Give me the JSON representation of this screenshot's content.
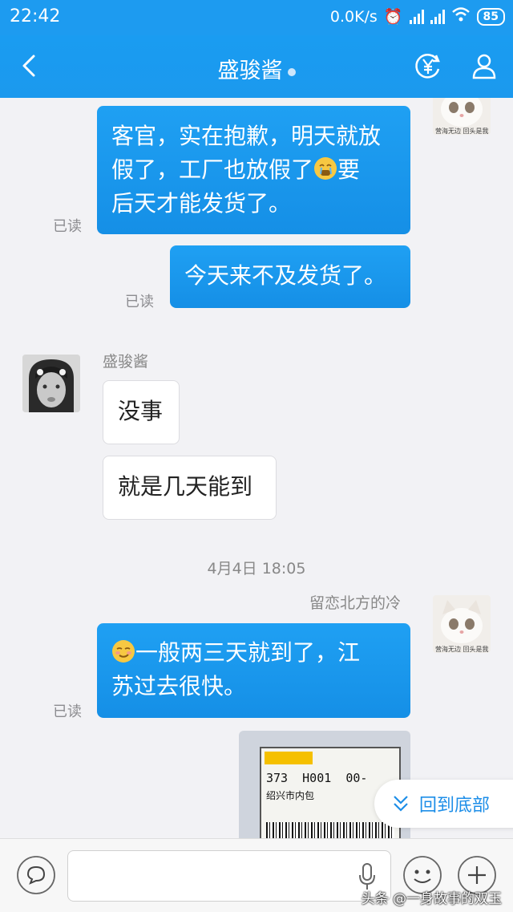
{
  "status": {
    "time": "22:42",
    "net_speed": "0.0K/s",
    "battery": "85"
  },
  "header": {
    "title": "盛骏酱"
  },
  "messages": {
    "m1": {
      "line1": "客官，实在抱歉，明天就放",
      "line2a": "假了，工厂也放假了",
      "line2b": "要",
      "line3": "后天才能发货了。",
      "read": "已读"
    },
    "m2": {
      "text": "今天来不及发货了。",
      "read": "已读"
    },
    "m3": {
      "sender": "盛骏酱",
      "text": "没事"
    },
    "m4": {
      "text": "就是几天能到"
    },
    "timestamp": "4月4日 18:05",
    "m5": {
      "sender": "留恋北方的冷",
      "line1": "一般两三天就到了，江",
      "line2": "苏过去很快。",
      "read": "已读"
    },
    "photo": {
      "code": "373  H001  00-",
      "region": "绍兴市内包"
    },
    "avatar_cat_caption": "营海无边 回头是我"
  },
  "back_to_bottom": "回到底部",
  "watermark": "头条 @一身故事的双玉",
  "colors": {
    "accent": "#1d9bf0",
    "background": "#f2f2f5"
  }
}
